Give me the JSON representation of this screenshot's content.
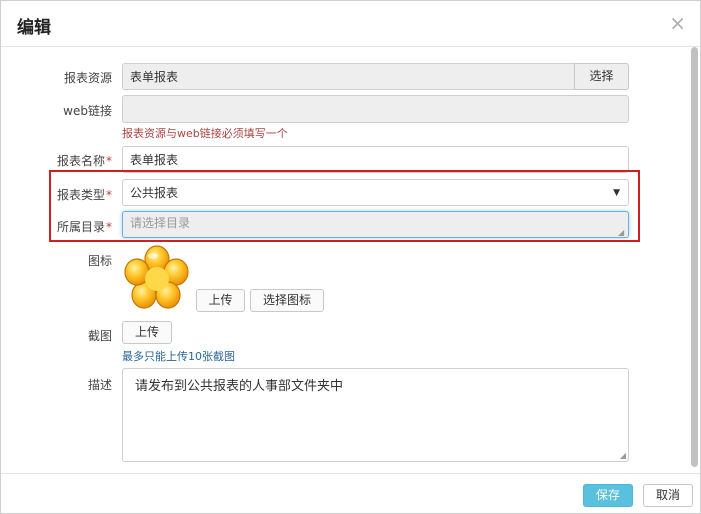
{
  "dialog": {
    "title": "编辑",
    "close_icon": "×"
  },
  "form": {
    "report_source": {
      "label": "报表资源",
      "value": "表单报表",
      "button": "选择"
    },
    "web_link": {
      "label": "web链接",
      "value": "",
      "hint": "报表资源与web链接必须填写一个"
    },
    "report_name": {
      "label": "报表名称",
      "required_mark": "*",
      "value": "表单报表"
    },
    "report_type": {
      "label": "报表类型",
      "required_mark": "*",
      "value": "公共报表",
      "arrow": "▼"
    },
    "directory": {
      "label": "所属目录",
      "required_mark": "*",
      "placeholder": "请选择目录"
    },
    "icon": {
      "label": "图标",
      "upload": "上传",
      "choose": "选择图标"
    },
    "screenshot": {
      "label": "截图",
      "upload": "上传",
      "hint": "最多只能上传10张截图"
    },
    "description": {
      "label": "描述",
      "value": "请发布到公共报表的人事部文件夹中"
    }
  },
  "footer": {
    "save": "保存",
    "cancel": "取消"
  },
  "colors": {
    "error_hint": "#a94442",
    "info_hint": "#2a6496",
    "save_button": "#5bc0de",
    "highlight_box": "#d11f1f",
    "focus_border": "#66afe9"
  }
}
